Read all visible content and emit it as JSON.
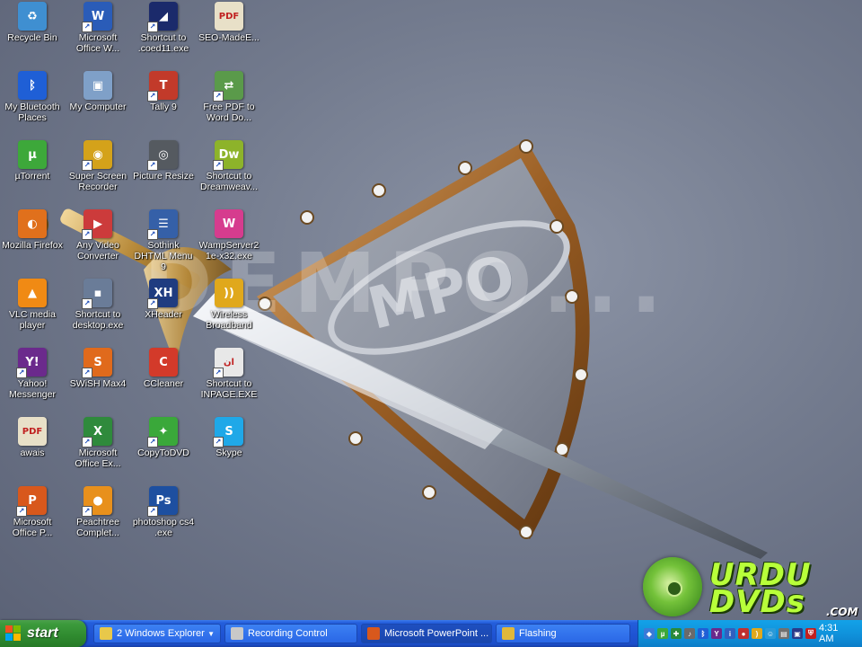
{
  "desktop": {
    "icons": [
      {
        "label": "Recycle Bin",
        "glyph": "♻",
        "color": "#3f8fd1",
        "shortcut": false
      },
      {
        "label": "Microsoft Office W...",
        "glyph": "W",
        "color": "#2a5cb8",
        "shortcut": true
      },
      {
        "label": "Shortcut to .coed11.exe",
        "glyph": "◢",
        "color": "#1b2a6b",
        "shortcut": true
      },
      {
        "label": "SEO-MadeE...",
        "glyph": "PDF",
        "color": "#e8e0c8",
        "shortcut": false
      },
      {
        "label": "My Bluetooth Places",
        "glyph": "ᛒ",
        "color": "#1f5fd6",
        "shortcut": false
      },
      {
        "label": "My Computer",
        "glyph": "▣",
        "color": "#7fa0c8",
        "shortcut": false
      },
      {
        "label": "Tally 9",
        "glyph": "T",
        "color": "#c23a2a",
        "shortcut": true
      },
      {
        "label": "Free PDF to Word Do...",
        "glyph": "⇄",
        "color": "#5a9a4a",
        "shortcut": true
      },
      {
        "label": "µTorrent",
        "glyph": "µ",
        "color": "#3da83a",
        "shortcut": false
      },
      {
        "label": "Super Screen Recorder",
        "glyph": "◉",
        "color": "#d4a21a",
        "shortcut": true
      },
      {
        "label": "Picture Resize",
        "glyph": "◎",
        "color": "#555a60",
        "shortcut": true
      },
      {
        "label": "Shortcut to Dreamweav...",
        "glyph": "Dw",
        "color": "#8db32a",
        "shortcut": true
      },
      {
        "label": "Mozilla Firefox",
        "glyph": "◐",
        "color": "#e0701c",
        "shortcut": false
      },
      {
        "label": "Any Video Converter",
        "glyph": "▶",
        "color": "#cc3b3b",
        "shortcut": true
      },
      {
        "label": "Sothink DHTML Menu 9",
        "glyph": "☰",
        "color": "#3560a8",
        "shortcut": true
      },
      {
        "label": "WampServer2 1e-x32.exe",
        "glyph": "W",
        "color": "#d63c8e",
        "shortcut": false
      },
      {
        "label": "VLC media player",
        "glyph": "▲",
        "color": "#f08a14",
        "shortcut": false
      },
      {
        "label": "Shortcut to desktop.exe",
        "glyph": "▪",
        "color": "#6a7c98",
        "shortcut": true
      },
      {
        "label": "XHeader",
        "glyph": "XH",
        "color": "#1f3c80",
        "shortcut": true
      },
      {
        "label": "Wireless Broadband",
        "glyph": "))",
        "color": "#e0a81c",
        "shortcut": false
      },
      {
        "label": "Yahoo! Messenger",
        "glyph": "Y!",
        "color": "#6b2a8c",
        "shortcut": true
      },
      {
        "label": "SWiSH Max4",
        "glyph": "S",
        "color": "#e06a1c",
        "shortcut": true
      },
      {
        "label": "CCleaner",
        "glyph": "C",
        "color": "#d33a2a",
        "shortcut": false
      },
      {
        "label": "Shortcut to INPAGE.EXE",
        "glyph": "ان",
        "color": "#e8e8e8",
        "shortcut": true
      },
      {
        "label": "awais",
        "glyph": "PDF",
        "color": "#e8e0c8",
        "shortcut": false
      },
      {
        "label": "Microsoft Office Ex...",
        "glyph": "X",
        "color": "#2f8a3c",
        "shortcut": true
      },
      {
        "label": "CopyToDVD",
        "glyph": "✦",
        "color": "#3aa83a",
        "shortcut": true
      },
      {
        "label": "Skype",
        "glyph": "S",
        "color": "#1fa8e8",
        "shortcut": true
      },
      {
        "label": "Microsoft Office P...",
        "glyph": "P",
        "color": "#d8581c",
        "shortcut": true
      },
      {
        "label": "Peachtree Complet...",
        "glyph": "●",
        "color": "#e8901c",
        "shortcut": true
      },
      {
        "label": "photoshop cs4 .exe",
        "glyph": "Ps",
        "color": "#1d4fa0",
        "shortcut": true
      }
    ],
    "watermark": "DEMPO...",
    "shield_text": "MPO",
    "brand": {
      "line1": "URDU",
      "line2": "DVDs",
      "com": ".COM"
    }
  },
  "taskbar": {
    "start_label": "start",
    "tasks": [
      {
        "label": "2 Windows Explorer",
        "icon": "folder-icon",
        "color": "#e8c84a",
        "active": false,
        "has_menu": true
      },
      {
        "label": "Recording Control",
        "icon": "recorder-icon",
        "color": "#c8c8c8",
        "active": false,
        "has_menu": false
      },
      {
        "label": "Microsoft PowerPoint ...",
        "icon": "powerpoint-icon",
        "color": "#d8581c",
        "active": true,
        "has_menu": false
      },
      {
        "label": "Flashing",
        "icon": "flash-icon",
        "color": "#e0b83a",
        "active": false,
        "has_menu": false
      }
    ],
    "tray_icons": [
      {
        "name": "network-icon",
        "color": "#3a7ad8",
        "glyph": "◆"
      },
      {
        "name": "torrent-tray-icon",
        "color": "#3da83a",
        "glyph": "µ"
      },
      {
        "name": "shield-tray-icon",
        "color": "#2a8a3a",
        "glyph": "✚"
      },
      {
        "name": "volume-icon",
        "color": "#6a6a6a",
        "glyph": "♪"
      },
      {
        "name": "bluetooth-tray-icon",
        "color": "#1f5fd6",
        "glyph": "ᛒ"
      },
      {
        "name": "yahoo-tray-icon",
        "color": "#6b2a8c",
        "glyph": "Y"
      },
      {
        "name": "info-tray-icon",
        "color": "#3060c0",
        "glyph": "i"
      },
      {
        "name": "recorder-tray-icon",
        "color": "#c03030",
        "glyph": "●"
      },
      {
        "name": "wifi-tray-icon",
        "color": "#e0a81c",
        "glyph": ")"
      },
      {
        "name": "messenger-tray-icon",
        "color": "#2a9ad8",
        "glyph": "☺"
      },
      {
        "name": "printer-tray-icon",
        "color": "#707070",
        "glyph": "▤"
      },
      {
        "name": "display-tray-icon",
        "color": "#2a3a8a",
        "glyph": "▣"
      },
      {
        "name": "security-tray-icon",
        "color": "#c02020",
        "glyph": "⛨"
      }
    ],
    "clock": "4:31 AM"
  }
}
